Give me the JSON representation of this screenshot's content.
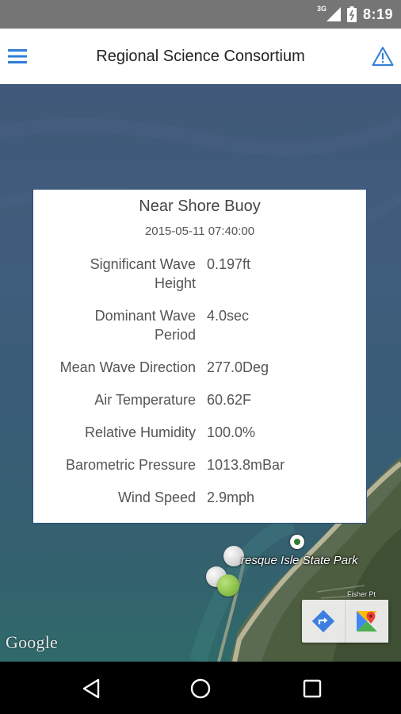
{
  "status_bar": {
    "network": "3G",
    "time": "8:19"
  },
  "app_bar": {
    "title": "Regional Science Consortium",
    "menu_icon": "hamburger-menu-icon",
    "alert_icon": "warning-triangle-icon",
    "accent_color": "#2f7ed8"
  },
  "info_card": {
    "title": "Near Shore Buoy",
    "timestamp": "2015-05-11 07:40:00",
    "rows": [
      {
        "label": "Significant Wave Height",
        "value": "0.197ft"
      },
      {
        "label": "Dominant Wave Period",
        "value": "4.0sec"
      },
      {
        "label": "Mean Wave Direction",
        "value": "277.0Deg"
      },
      {
        "label": "Air Temperature",
        "value": "60.62F"
      },
      {
        "label": "Relative Humidity",
        "value": "100.0%"
      },
      {
        "label": "Barometric Pressure",
        "value": "1013.8mBar"
      },
      {
        "label": "Wind Speed",
        "value": "2.9mph"
      }
    ]
  },
  "map": {
    "place_label": "resque Isle State Park",
    "small_label": "Fisher Pt",
    "attribution": "Google",
    "directions_icon": "directions-icon",
    "google-maps_icon": "google-maps-icon"
  },
  "nav_bar": {
    "back_icon": "back-triangle-icon",
    "home_icon": "home-circle-icon",
    "recents_icon": "recents-square-icon"
  }
}
